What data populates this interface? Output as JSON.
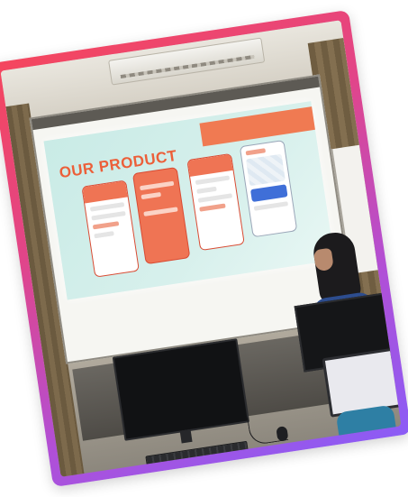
{
  "photo": {
    "subject": "",
    "slide": {
      "title": "OUR PRODUCT",
      "subtitle": "",
      "banner_logo_text": "",
      "footer_text": "",
      "phones": 4,
      "accent_color": "#ec5f39",
      "background_color": "#cdece7"
    },
    "frame_gradient": [
      "#f5465d",
      "#b14fd6",
      "#8b5cf6"
    ]
  }
}
